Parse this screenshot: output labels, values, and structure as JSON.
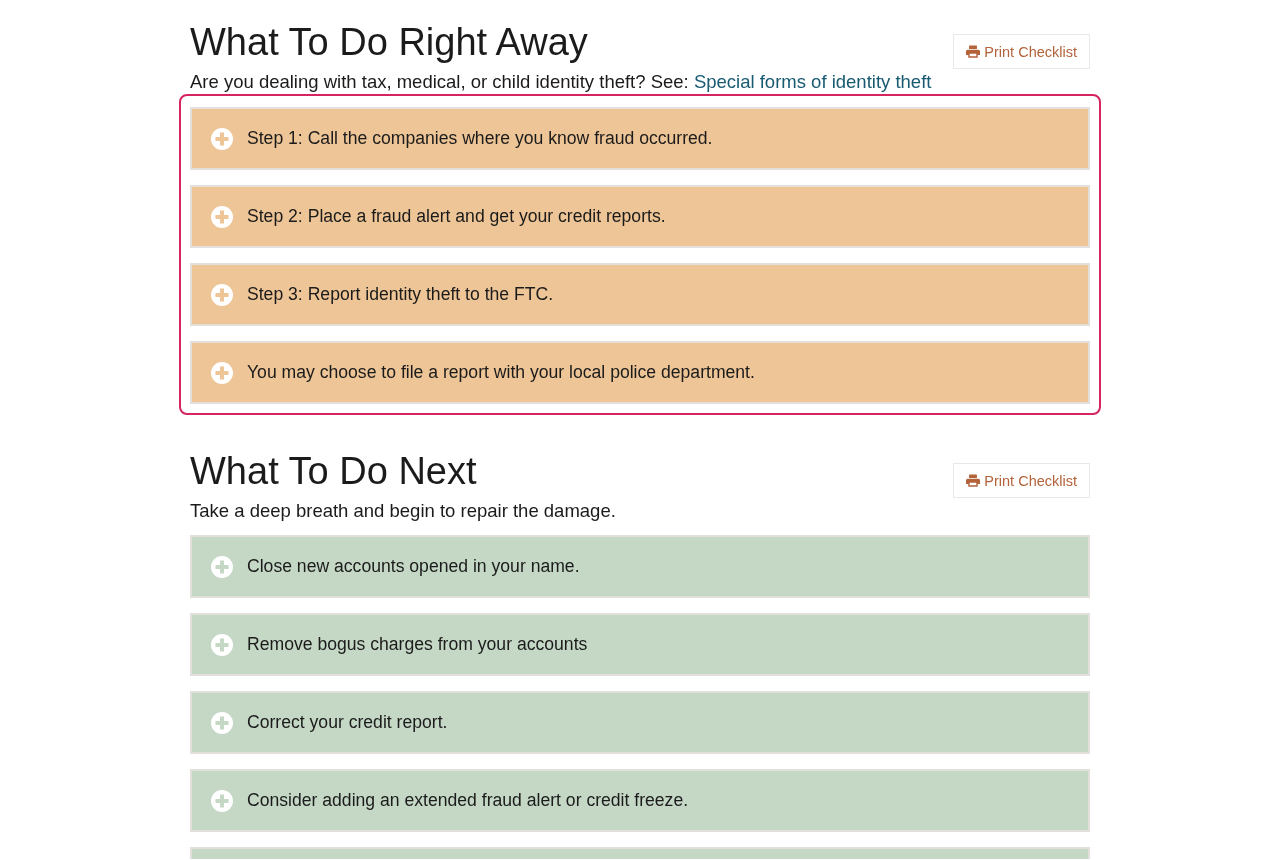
{
  "sections": [
    {
      "title": "What To Do Right Away",
      "print_button": "Print Checklist",
      "intro": {
        "text": "Are you dealing with tax, medical, or child identity theft? See:",
        "link": "Special forms of identity theft"
      },
      "highlighted": true,
      "color": "#eec596",
      "more_below": false,
      "items": [
        {
          "label": "Step 1: Call the companies where you know fraud occurred.",
          "expanded": false
        },
        {
          "label": "Step 2: Place a fraud alert and get your credit reports.",
          "expanded": false
        },
        {
          "label": "Step 3: Report identity theft to the FTC.",
          "expanded": false
        },
        {
          "label": "You may choose to file a report with your local police department.",
          "expanded": false
        }
      ]
    },
    {
      "title": "What To Do Next",
      "print_button": "Print Checklist",
      "intro": {
        "text": "Take a deep breath and begin to repair the damage."
      },
      "highlighted": false,
      "color": "#c5d8c6",
      "more_below": true,
      "items": [
        {
          "label": "Close new accounts opened in your name.",
          "expanded": false
        },
        {
          "label": "Remove bogus charges from your accounts",
          "expanded": false
        },
        {
          "label": "Correct your credit report.",
          "expanded": false
        },
        {
          "label": "Consider adding an extended fraud alert or credit freeze.",
          "expanded": false
        }
      ]
    }
  ]
}
